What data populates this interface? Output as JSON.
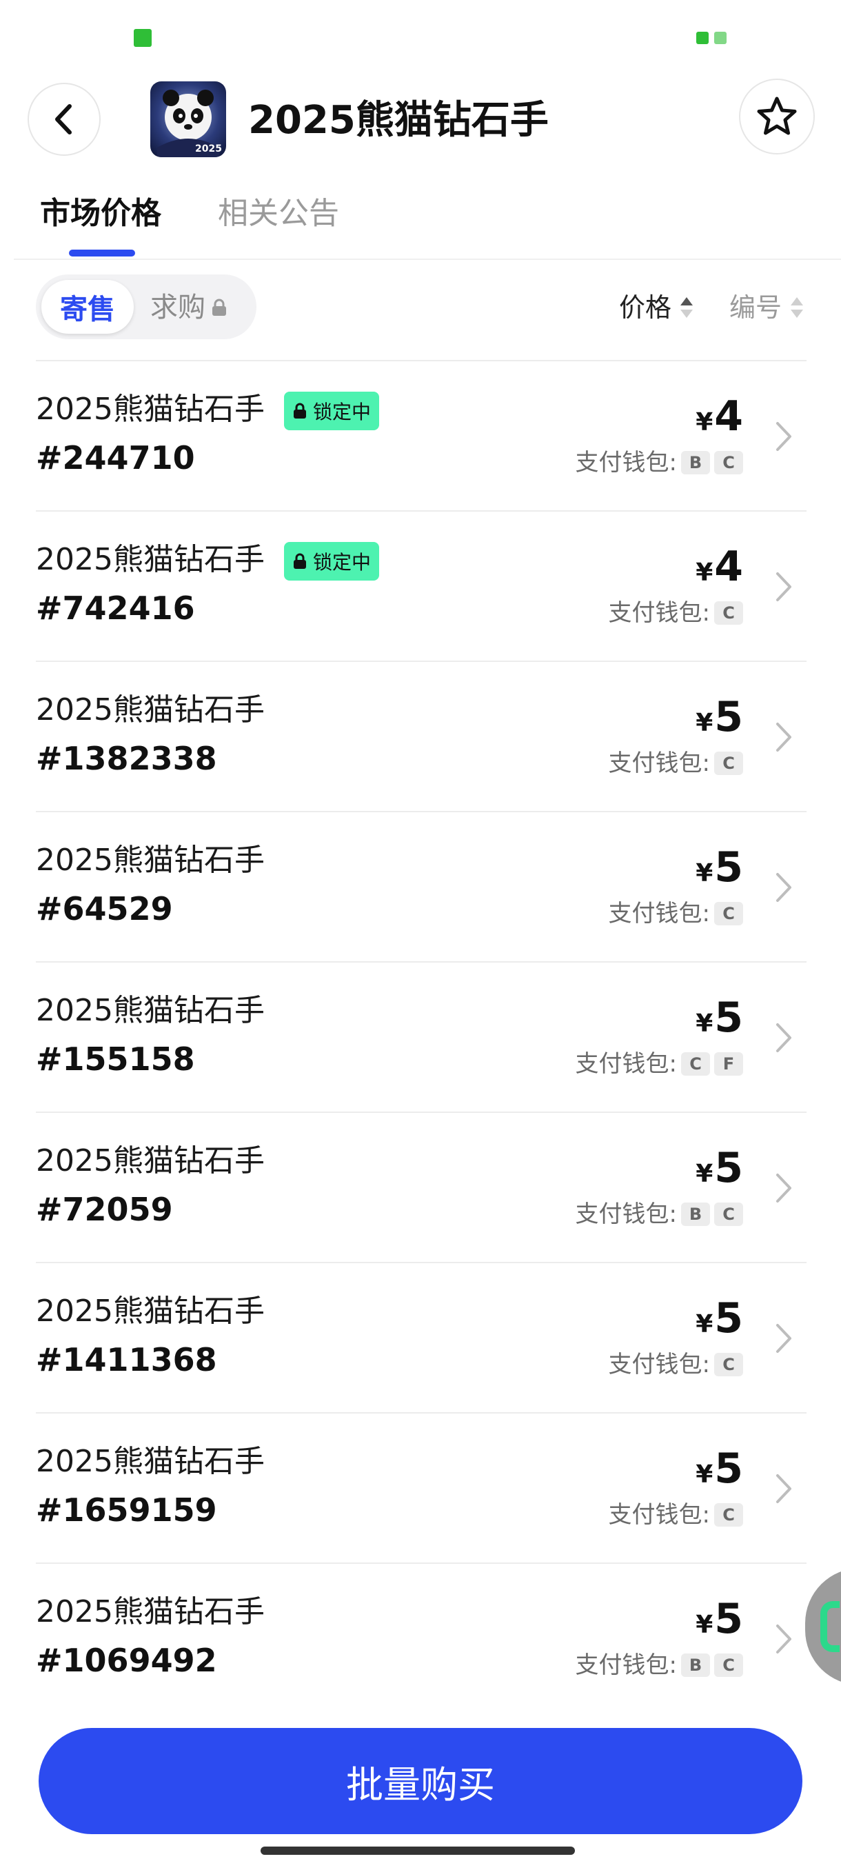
{
  "header": {
    "title": "2025熊猫钻石手",
    "thumb_text": "2025"
  },
  "tabs": [
    {
      "label": "市场价格",
      "active": true
    },
    {
      "label": "相关公告",
      "active": false
    }
  ],
  "filter": {
    "sell_label": "寄售",
    "buy_label": "求购",
    "sort_price_label": "价格",
    "sort_number_label": "编号"
  },
  "list": {
    "wallet_label": "支付钱包:",
    "locked_label": "锁定中",
    "currency": "¥",
    "items": [
      {
        "name": "2025熊猫钻石手",
        "id": "#244710",
        "price": "4",
        "wallets": [
          "B",
          "C"
        ],
        "locked": true
      },
      {
        "name": "2025熊猫钻石手",
        "id": "#742416",
        "price": "4",
        "wallets": [
          "C"
        ],
        "locked": true
      },
      {
        "name": "2025熊猫钻石手",
        "id": "#1382338",
        "price": "5",
        "wallets": [
          "C"
        ],
        "locked": false
      },
      {
        "name": "2025熊猫钻石手",
        "id": "#64529",
        "price": "5",
        "wallets": [
          "C"
        ],
        "locked": false
      },
      {
        "name": "2025熊猫钻石手",
        "id": "#155158",
        "price": "5",
        "wallets": [
          "C",
          "F"
        ],
        "locked": false
      },
      {
        "name": "2025熊猫钻石手",
        "id": "#72059",
        "price": "5",
        "wallets": [
          "B",
          "C"
        ],
        "locked": false
      },
      {
        "name": "2025熊猫钻石手",
        "id": "#1411368",
        "price": "5",
        "wallets": [
          "C"
        ],
        "locked": false
      },
      {
        "name": "2025熊猫钻石手",
        "id": "#1659159",
        "price": "5",
        "wallets": [
          "C"
        ],
        "locked": false
      },
      {
        "name": "2025熊猫钻石手",
        "id": "#1069492",
        "price": "5",
        "wallets": [
          "B",
          "C"
        ],
        "locked": false
      }
    ]
  },
  "footer": {
    "buy_button": "批量购买"
  },
  "colors": {
    "accent": "#2c4bf0",
    "locked_bg": "#4df2b0"
  }
}
